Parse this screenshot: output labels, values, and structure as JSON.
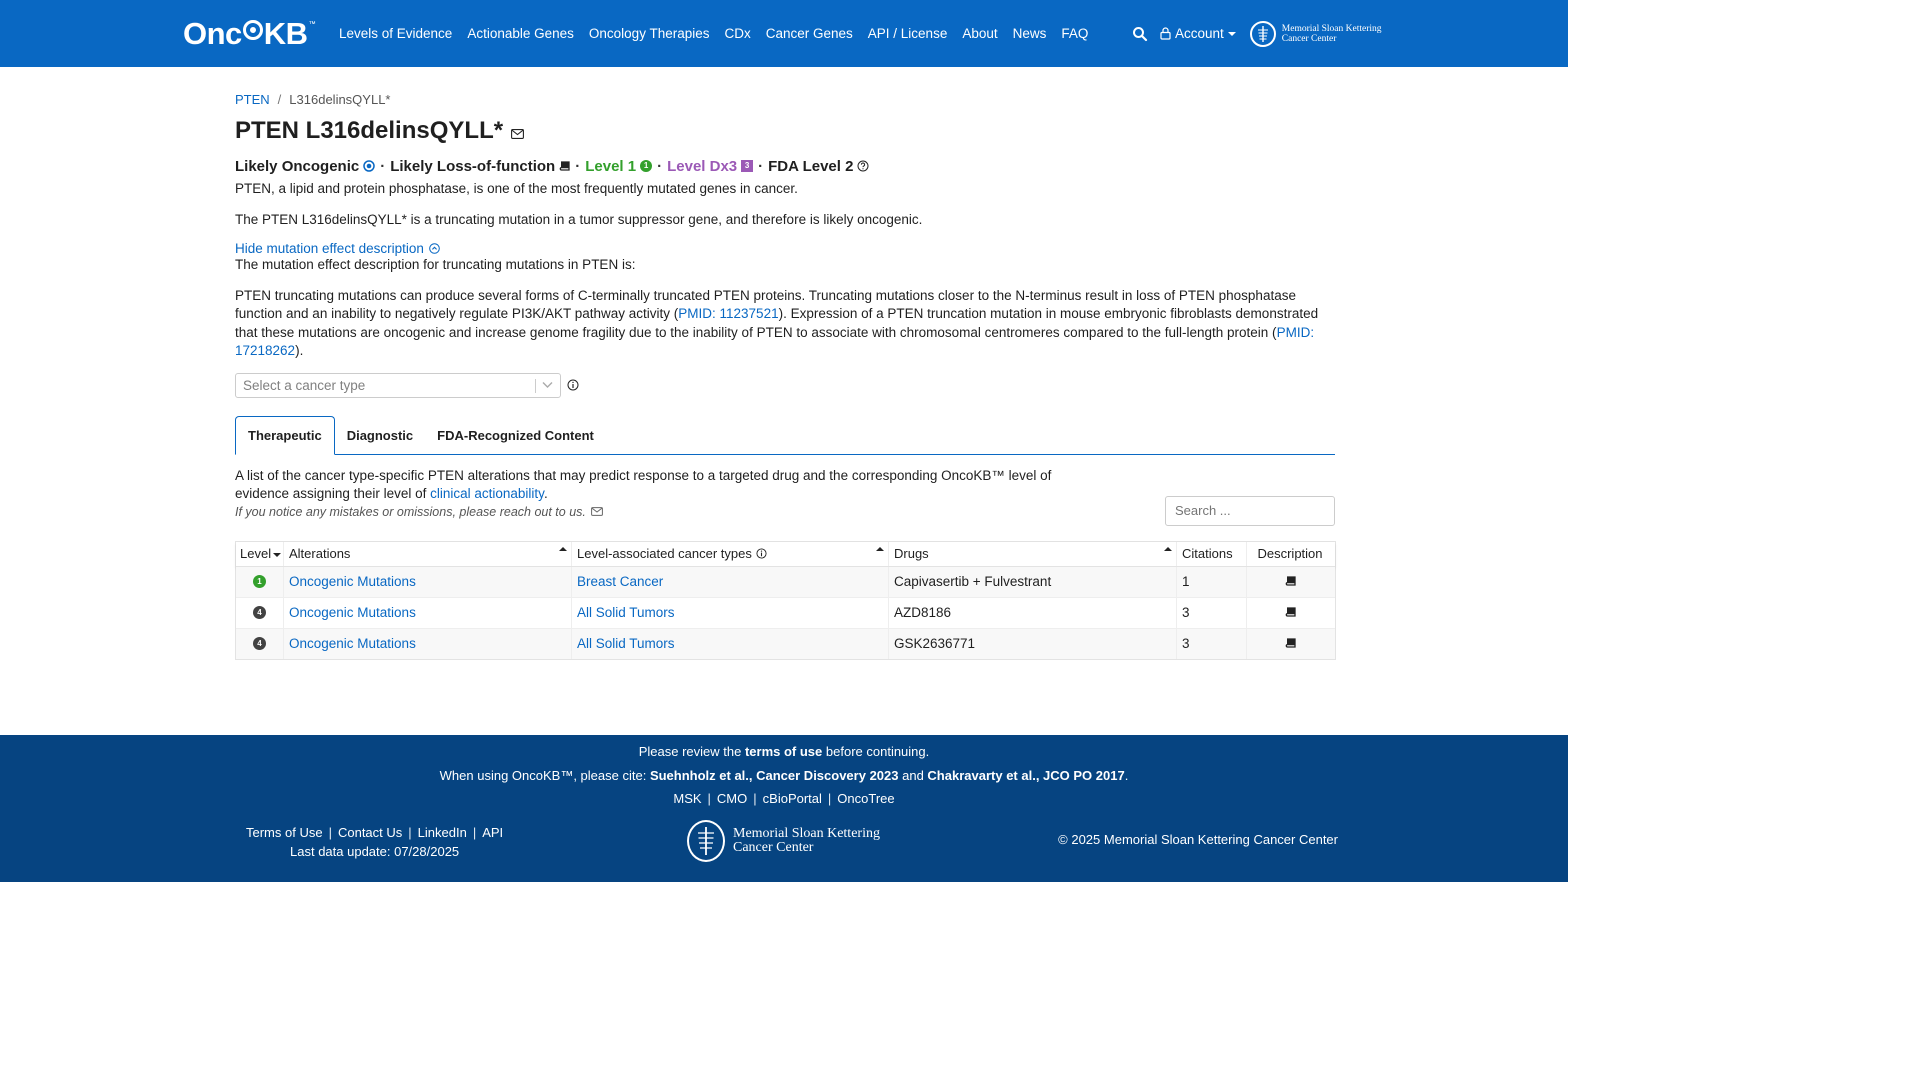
{
  "navbar": {
    "brand": {
      "part1": "Onc",
      "part2": "KB",
      "tm": "™"
    },
    "links": [
      "Levels of Evidence",
      "Actionable Genes",
      "Oncology Therapies",
      "CDx",
      "Cancer Genes",
      "API / License",
      "About",
      "News",
      "FAQ"
    ],
    "account_label": "Account",
    "msk_line1": "Memorial Sloan Kettering",
    "msk_line2": "Cancer Center"
  },
  "breadcrumb": {
    "gene": "PTEN",
    "sep": "/",
    "current": "L316delinsQYLL*"
  },
  "title": "PTEN L316delinsQYLL*",
  "subtitle": {
    "oncogenic": "Likely Oncogenic",
    "effect": "Likely Loss-of-function",
    "level1": "Level 1",
    "level1_badge": "1",
    "leveldx": "Level Dx3",
    "leveldx_badge": "3",
    "fda": "FDA Level 2",
    "dot": "·"
  },
  "gene_summary": "PTEN, a lipid and protein phosphatase, is one of the most frequently mutated genes in cancer.",
  "variant_summary": "The PTEN L316delinsQYLL* is a truncating mutation in a tumor suppressor gene, and therefore is likely oncogenic.",
  "hide_link": "Hide mutation effect description",
  "effect_intro": "The mutation effect description for truncating mutations in PTEN is:",
  "effect_description": {
    "part1": "PTEN truncating mutations can produce several forms of C-terminally truncated PTEN proteins. Truncating mutations closer to the N-terminus result in loss of PTEN phosphatase function and an inability to negatively regulate PI3K/AKT pathway activity (",
    "pmid1": "PMID: 11237521",
    "part2": "). Expression of a PTEN truncation mutation in mouse embryonic fibroblasts demonstrated that these mutations are oncogenic and increase genome fragility due to the inability of PTEN to associate with chromosomal centromeres compared to the full-length protein (",
    "pmid2": "PMID: 17218262",
    "part3": ")."
  },
  "cancer_select_placeholder": "Select a cancer type",
  "tabs": [
    "Therapeutic",
    "Diagnostic",
    "FDA-Recognized Content"
  ],
  "tab_desc": {
    "part1": "A list of the cancer type-specific PTEN alterations that may predict response to a targeted drug and the corresponding OncoKB™ level of evidence assigning their level of ",
    "link": "clinical actionability",
    "part2": "."
  },
  "notice": "If you notice any mistakes or omissions, please reach out to us.",
  "search_placeholder": "Search ...",
  "table": {
    "headers": [
      "Level",
      "Alterations",
      "Level-associated cancer types",
      "Drugs",
      "Citations",
      "Description"
    ],
    "rows": [
      {
        "level": "1",
        "level_color": "#33a02c",
        "alteration": "Oncogenic Mutations",
        "cancer_type": "Breast Cancer",
        "drugs": "Capivasertib + Fulvestrant",
        "citations": "1"
      },
      {
        "level": "4",
        "level_color": "#424242",
        "alteration": "Oncogenic Mutations",
        "cancer_type": "All Solid Tumors",
        "drugs": "AZD8186",
        "citations": "3"
      },
      {
        "level": "4",
        "level_color": "#424242",
        "alteration": "Oncogenic Mutations",
        "cancer_type": "All Solid Tumors",
        "drugs": "GSK2636771",
        "citations": "3"
      }
    ]
  },
  "footer": {
    "review_pre": "Please review the ",
    "review_link": "terms of use",
    "review_post": " before continuing.",
    "cite_pre": "When using OncoKB™, please cite: ",
    "cite1": "Suehnholz et al., Cancer Discovery 2023",
    "cite_mid": " and ",
    "cite2": "Chakravarty et al., JCO PO 2017",
    "cite_post": ".",
    "links": [
      "MSK",
      "CMO",
      "cBioPortal",
      "OncoTree"
    ],
    "left_links": [
      "Terms of Use",
      "Contact Us",
      "LinkedIn",
      "API"
    ],
    "last_update": "Last data update: 07/28/2025",
    "msk_line1": "Memorial Sloan Kettering",
    "msk_line2": "Cancer Center",
    "copyright": "© 2025 Memorial Sloan Kettering Cancer Center"
  },
  "colors": {
    "primary": "#0968c3",
    "footer": "#064481",
    "level1": "#33a02c",
    "dx": "#9b59b6"
  }
}
